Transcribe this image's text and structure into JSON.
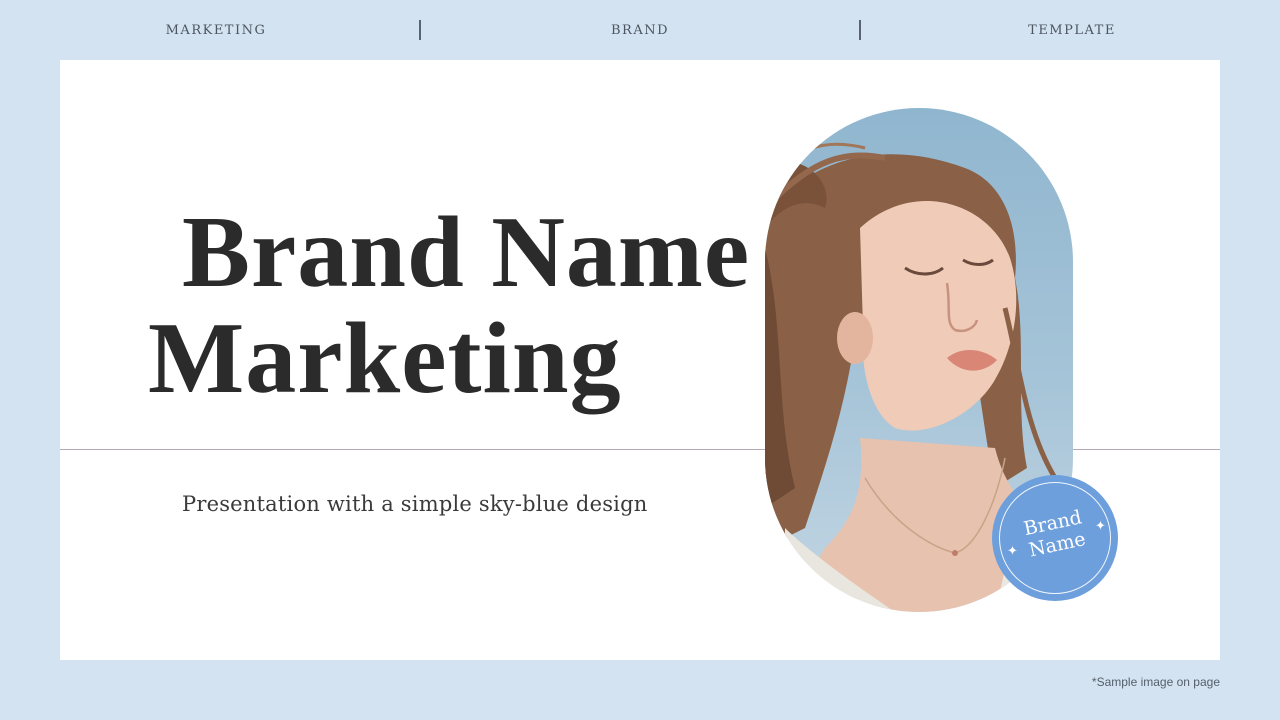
{
  "nav": {
    "items": [
      "MARKETING",
      "BRAND",
      "TEMPLATE"
    ]
  },
  "slide": {
    "title_line1": "Brand Name",
    "title_line2": "Marketing",
    "subtitle": "Presentation with a simple sky-blue design",
    "badge_line1": "Brand",
    "badge_line2": "Name",
    "photo_icon": "woman-portrait-photo"
  },
  "footnote": "*Sample image on page",
  "colors": {
    "page_background": "#d3e3f1",
    "card_background": "#ffffff",
    "badge": "#6d9fdc",
    "title_text": "#2b2b2b"
  }
}
